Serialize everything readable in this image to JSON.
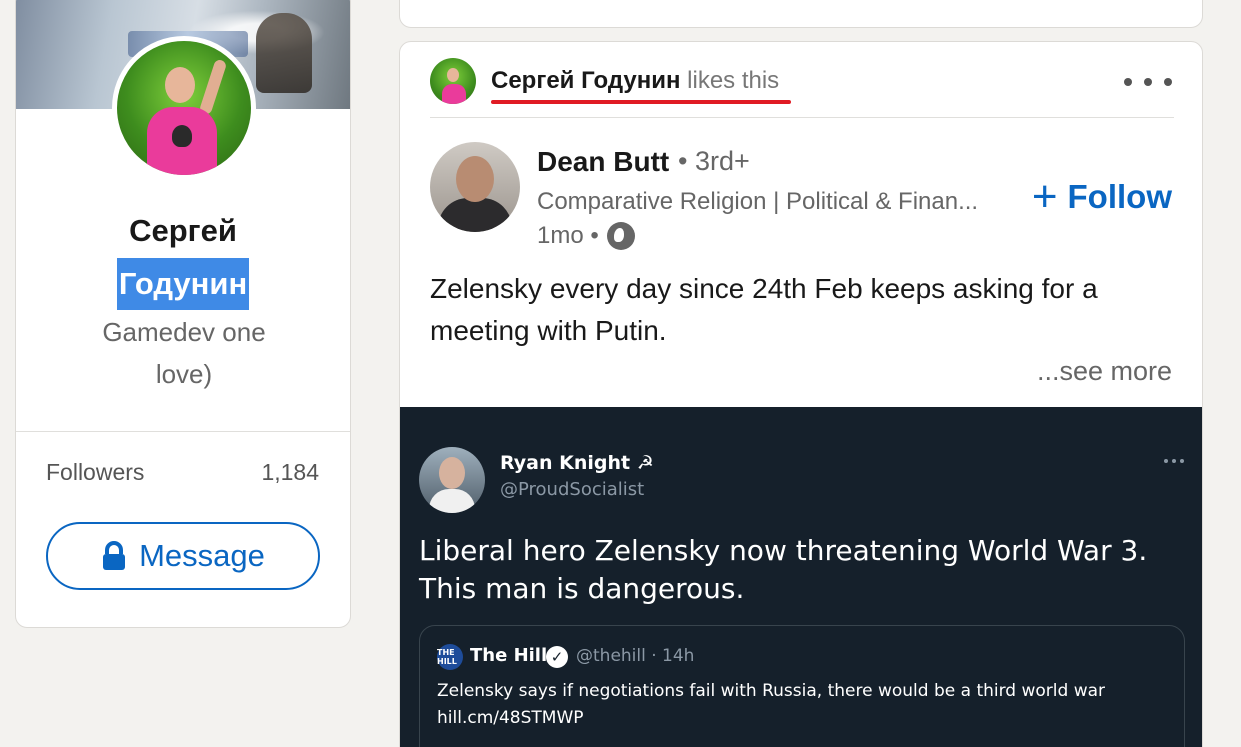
{
  "profile": {
    "first_name": "Сергей",
    "last_name": "Годунин",
    "headline": "Gamedev one love)",
    "followers_label": "Followers",
    "followers_count": "1,184",
    "message_label": "Message",
    "icons": {
      "lock": "lock-icon"
    },
    "colors": {
      "selection": "#3f8ae6",
      "accent": "#0a66c2"
    }
  },
  "post": {
    "social_context": {
      "liker_name": "Сергей Годунин",
      "action": "likes this"
    },
    "author": {
      "name": "Dean Butt",
      "degree": "• 3rd+",
      "headline": "Comparative Religion | Political & Finan...",
      "time": "1mo •"
    },
    "follow_label": "Follow",
    "text": "Zelensky every day since 24th Feb keeps asking for a meeting with Putin.",
    "see_more": "...see more",
    "annotation_color": "#e01b24"
  },
  "tweet": {
    "name": "Ryan Knight ☭",
    "handle": "@ProudSocialist",
    "text": "Liberal hero Zelensky now threatening World War 3. This man is dangerous.",
    "quote": {
      "logo_text": "THE HILL",
      "name": "The Hill",
      "meta": "@thehill · 14h",
      "text": "Zelensky says if negotiations fail with Russia, there would be a third world war",
      "link": "hill.cm/48STMWP"
    },
    "colors": {
      "background": "#15202b",
      "muted": "#8b98a5"
    }
  }
}
